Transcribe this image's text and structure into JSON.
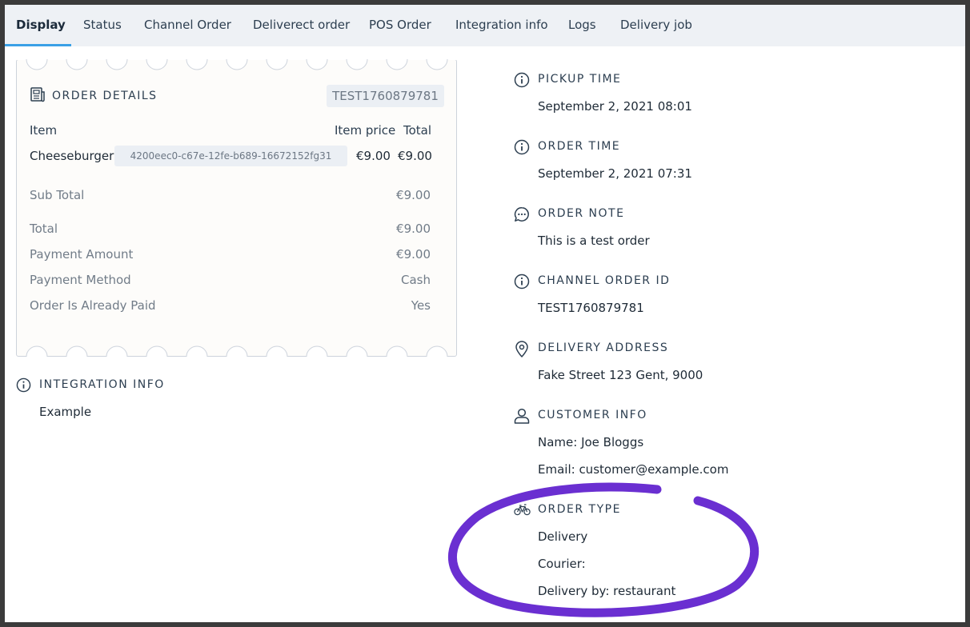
{
  "tabs": [
    "Display",
    "Status",
    "Channel Order",
    "Deliverect order",
    "POS Order",
    "Integration info",
    "Logs",
    "Delivery job"
  ],
  "order_details": {
    "title": "ORDER DETAILS",
    "order_ref": "TEST1760879781",
    "col_item": "Item",
    "col_price": "Item price",
    "col_total": "Total",
    "item_name": "Cheeseburger",
    "item_id": "4200eec0-c67e-12fe-b689-16672152fg31",
    "item_price": "€9.00",
    "item_total": "€9.00",
    "sub_total_label": "Sub Total",
    "sub_total_value": "€9.00",
    "total_label": "Total",
    "total_value": "€9.00",
    "payment_amount_label": "Payment Amount",
    "payment_amount_value": "€9.00",
    "payment_method_label": "Payment Method",
    "payment_method_value": "Cash",
    "paid_label": "Order Is Already Paid",
    "paid_value": "Yes"
  },
  "integration_info": {
    "label": "INTEGRATION INFO",
    "value": "Example"
  },
  "pickup_time": {
    "label": "PICKUP TIME",
    "value": "September 2, 2021 08:01"
  },
  "order_time": {
    "label": "ORDER TIME",
    "value": "September 2, 2021 07:31"
  },
  "order_note": {
    "label": "ORDER NOTE",
    "value": "This is a test order"
  },
  "channel_order_id": {
    "label": "CHANNEL ORDER ID",
    "value": "TEST1760879781"
  },
  "delivery_address": {
    "label": "DELIVERY ADDRESS",
    "value": "Fake Street 123 Gent, 9000"
  },
  "customer_info": {
    "label": "CUSTOMER INFO",
    "name": "Name: Joe Bloggs",
    "email": "Email: customer@example.com"
  },
  "order_type": {
    "label": "ORDER TYPE",
    "type": "Delivery",
    "courier": "Courier:",
    "delivery_by": "Delivery by: restaurant"
  },
  "colors": {
    "accent": "#3aa0e6",
    "annotation": "#6a2fd1",
    "text": "#2c3e50"
  },
  "icons": [
    "info-icon",
    "receipt-icon",
    "chat-icon",
    "location-icon",
    "user-icon",
    "bicycle-icon"
  ]
}
